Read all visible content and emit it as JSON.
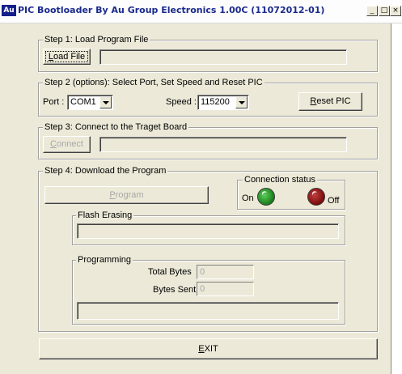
{
  "window": {
    "title": "PIC Bootloader By Au Group Electronics 1.00C (11072012-01)",
    "icon_text": "Au",
    "caption_buttons": {
      "minimize": "_",
      "maximize": "□",
      "close": "×"
    }
  },
  "step1": {
    "title": "Step 1: Load Program File",
    "load_button_label": "Load File",
    "file_path": ""
  },
  "step2": {
    "title": "Step 2 (options): Select Port, Set Speed and Reset PIC",
    "port_label": "Port :",
    "port_value": "COM1",
    "speed_label": "Speed :",
    "speed_value": "115200",
    "reset_button_label": "Reset PIC"
  },
  "step3": {
    "title": "Step 3: Connect to the Traget Board",
    "connect_button_label": "Connect",
    "status_text": ""
  },
  "step4": {
    "title": "Step 4: Download the Program",
    "program_button_label": "Program",
    "connection_status": {
      "title": "Connection status",
      "on_label": "On",
      "off_label": "Off",
      "on_color": "#1a7a1a",
      "off_color": "#7a0a0a"
    },
    "flash_erasing": {
      "title": "Flash Erasing",
      "progress": 0
    },
    "programming": {
      "title": "Programming",
      "total_bytes_label": "Total Bytes",
      "total_bytes_value": "0",
      "bytes_sent_label": "Bytes Sent",
      "bytes_sent_value": "0",
      "progress": 0
    }
  },
  "exit_button_label": "EXIT"
}
